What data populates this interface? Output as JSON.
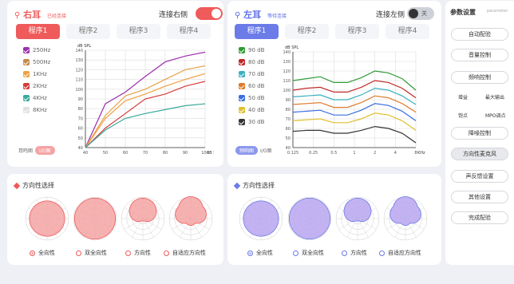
{
  "right_ear": {
    "title": "右耳",
    "subtitle": "已经连接",
    "connect_label": "连接右侧",
    "toggle_text": "",
    "accent": "#ef5a5a",
    "tabs": [
      "程序1",
      "程序2",
      "程序3",
      "程序4"
    ],
    "active_tab": 0,
    "legend": [
      {
        "label": "250Hz",
        "color": "#9b2fae"
      },
      {
        "label": "500Hz",
        "color": "#e8a24a"
      },
      {
        "label": "1KHz",
        "color": "#f0a040"
      },
      {
        "label": "2KHz",
        "color": "#d63a3a"
      },
      {
        "label": "4KHz",
        "color": "#3aa99a"
      },
      {
        "label": "8KHz",
        "color": "#c8c8c8"
      }
    ],
    "mode_label": "耳鸣图",
    "mode_pill": "I/O图"
  },
  "left_ear": {
    "title": "左耳",
    "subtitle": "等待连接",
    "connect_label": "连接左侧",
    "toggle_text": "关",
    "accent": "#5b6ee8",
    "tabs": [
      "程序1",
      "程序2",
      "程序3",
      "程序4"
    ],
    "active_tab": 0,
    "legend": [
      {
        "label": "90 dB",
        "color": "#2e9a35"
      },
      {
        "label": "80 dB",
        "color": "#c02828"
      },
      {
        "label": "70 dB",
        "color": "#3ab0c0"
      },
      {
        "label": "60 dB",
        "color": "#e07a2a"
      },
      {
        "label": "50 dB",
        "color": "#3a6ee0"
      },
      {
        "label": "40 dB",
        "color": "#e0c030"
      },
      {
        "label": "30 dB",
        "color": "#333333"
      }
    ],
    "mode_pill": "频响图",
    "mode_label": "I/O图"
  },
  "chart_data": [
    {
      "type": "line",
      "ylabel": "dB SPL",
      "xlabel": "dB SPL",
      "x": [
        40,
        50,
        60,
        70,
        80,
        90,
        100
      ],
      "x_ticks": [
        "40",
        "50",
        "60",
        "70",
        "80",
        "90",
        "100"
      ],
      "y_ticks": [
        "40",
        "50",
        "60",
        "70",
        "80",
        "90",
        "100",
        "110",
        "120",
        "130",
        "140"
      ],
      "ylim": [
        40,
        140
      ],
      "series": [
        {
          "name": "250Hz",
          "values": [
            40,
            85,
            97,
            113,
            128,
            134,
            138
          ]
        },
        {
          "name": "500Hz",
          "values": [
            40,
            73,
            93,
            100,
            110,
            120,
            124
          ]
        },
        {
          "name": "1KHz",
          "values": [
            40,
            70,
            88,
            95,
            103,
            110,
            116
          ]
        },
        {
          "name": "2KHz",
          "values": [
            40,
            60,
            75,
            90,
            95,
            103,
            108
          ]
        },
        {
          "name": "4KHz",
          "values": [
            40,
            58,
            70,
            75,
            79,
            83,
            85
          ]
        }
      ]
    },
    {
      "type": "line",
      "ylabel": "dB SPL",
      "xlabel": "KHz",
      "x_ticks": [
        "0.125",
        "0.25",
        "0.5",
        "1",
        "2",
        "4",
        "8"
      ],
      "y_ticks": [
        "40",
        "50",
        "60",
        "70",
        "80",
        "90",
        "100",
        "110",
        "120",
        "130",
        "140"
      ],
      "ylim": [
        40,
        140
      ],
      "series": [
        {
          "name": "90 dB",
          "values": [
            110,
            112,
            114,
            108,
            108,
            113,
            120,
            118,
            112,
            100
          ]
        },
        {
          "name": "80 dB",
          "values": [
            100,
            102,
            103,
            98,
            98,
            103,
            110,
            108,
            102,
            92
          ]
        },
        {
          "name": "70 dB",
          "values": [
            93,
            94,
            95,
            90,
            90,
            95,
            102,
            100,
            94,
            85
          ]
        },
        {
          "name": "60 dB",
          "values": [
            85,
            86,
            87,
            82,
            82,
            87,
            94,
            92,
            86,
            77
          ]
        },
        {
          "name": "50 dB",
          "values": [
            77,
            78,
            79,
            74,
            74,
            79,
            86,
            84,
            78,
            68
          ]
        },
        {
          "name": "40 dB",
          "values": [
            68,
            69,
            70,
            66,
            66,
            70,
            76,
            74,
            68,
            58
          ]
        },
        {
          "name": "30 dB",
          "values": [
            57,
            58,
            58,
            55,
            55,
            58,
            62,
            60,
            55,
            45
          ]
        }
      ]
    }
  ],
  "right_dir": {
    "title": "方向性选择",
    "accent": "#ef5a5a",
    "fill": "#f5a3a3",
    "options": [
      "全向性",
      "双全向性",
      "方向性",
      "自适应方向性"
    ]
  },
  "left_dir": {
    "title": "方向性选择",
    "accent": "#6b7be8",
    "fill": "#b9a6f0",
    "options": [
      "全向性",
      "双全向性",
      "方向性",
      "自适应方向性"
    ]
  },
  "sidebar": {
    "title": "参数设置",
    "subtitle": "parameter",
    "buttons": [
      "自动配验",
      "音量控制",
      "频响控制"
    ],
    "small_items": [
      "增益",
      "最大输出",
      "饱点",
      "MPO调点"
    ],
    "buttons2": [
      "降噪控制",
      "方向性麦克风",
      "声反馈设置",
      "其他设置",
      "完成配验"
    ],
    "active": "方向性麦克风"
  }
}
